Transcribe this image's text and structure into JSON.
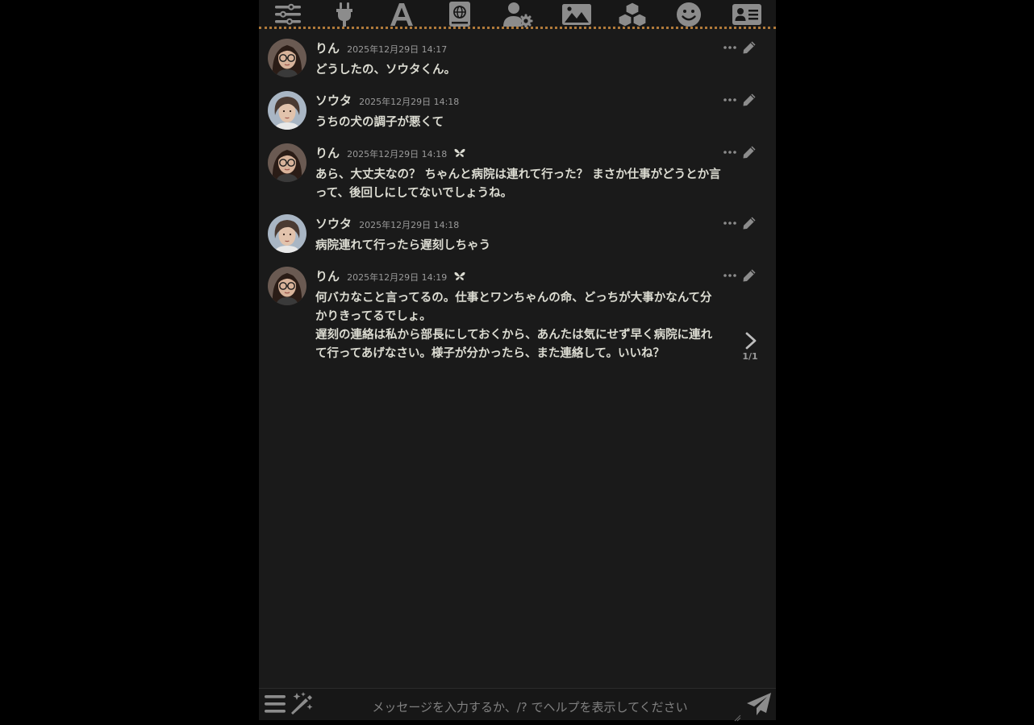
{
  "colors": {
    "panel_bg": "#1a1a1a",
    "page_bg": "#000000",
    "text": "#dcdcd2",
    "muted": "#9a9a9a",
    "icon": "#8c8c8c",
    "topbar_border": "#b07a3a"
  },
  "toolbar": {
    "icons": [
      "sliders-icon",
      "plug-icon",
      "font-icon",
      "book-atlas-icon",
      "user-gear-icon",
      "image-icon",
      "cubes-icon",
      "smile-icon",
      "address-card-icon"
    ]
  },
  "messages": [
    {
      "name": "りん",
      "time": "2025年12月29日 14:17",
      "text": "どうしたの、ソウタくん。",
      "avatar": "rin",
      "flag": false
    },
    {
      "name": "ソウタ",
      "time": "2025年12月29日 14:18",
      "text": "うちの犬の調子が悪くて",
      "avatar": "souta",
      "flag": false
    },
    {
      "name": "りん",
      "time": "2025年12月29日 14:18",
      "text": "あら、大丈夫なの？ ちゃんと病院は連れて行った？ まさか仕事がどうとか言\nって、後回しにしてないでしょうね。",
      "avatar": "rin",
      "flag": true
    },
    {
      "name": "ソウタ",
      "time": "2025年12月29日 14:18",
      "text": "病院連れて行ったら遅刻しちゃう",
      "avatar": "souta",
      "flag": false
    },
    {
      "name": "りん",
      "time": "2025年12月29日 14:19",
      "text": "何バカなこと言ってるの。仕事とワンちゃんの命、どっちが大事かなんて分\nかりきってるでしょ。\n遅刻の連絡は私から部長にしておくから、あんたは気にせず早く病院に連れ\nて行ってあげなさい。様子が分かったら、また連絡して。いいね？",
      "avatar": "rin",
      "flag": true
    }
  ],
  "swipe": {
    "counter": "1/1"
  },
  "composer": {
    "placeholder": "メッセージを入力するか、/? でヘルプを表示してください",
    "value": ""
  }
}
